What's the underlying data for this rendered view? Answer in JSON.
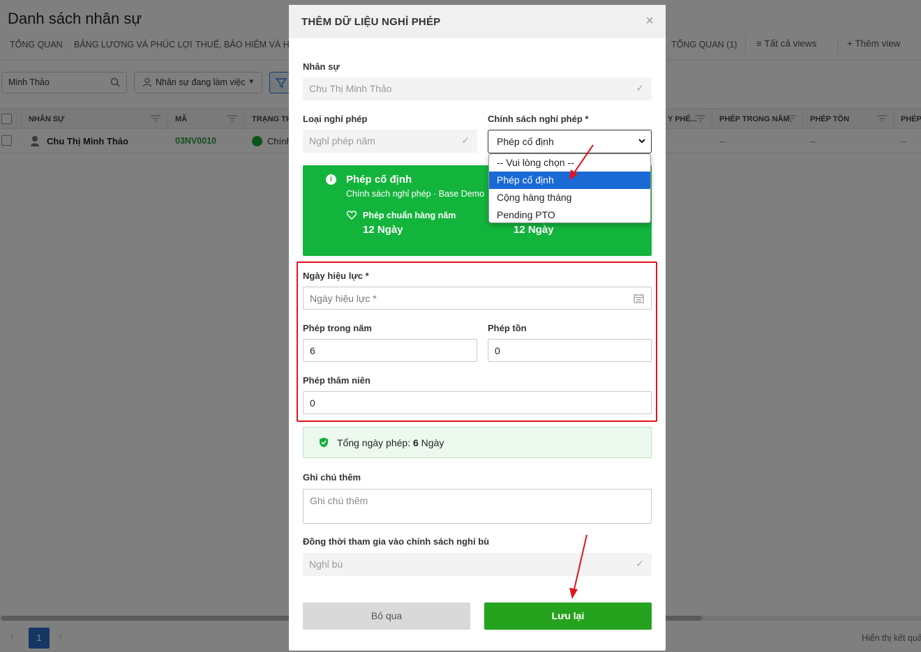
{
  "page": {
    "title": "Danh sách nhân sự",
    "tabs": [
      "TỔNG QUAN",
      "BẢNG LƯƠNG VÀ PHÚC LỢI",
      "THUẾ, BẢO HIỂM VÀ HÀN"
    ],
    "right_tab": "TỔNG QUAN (1)",
    "all_views": "Tất cả views",
    "add_view": "Thêm view",
    "search_value": "Minh Thảo",
    "status_filter": "Nhân sự đang làm việc"
  },
  "table": {
    "headers": [
      "NHÂN SỰ",
      "MÃ",
      "TRẠNG TH",
      "Y PHÉ...",
      "PHÉP TRONG NĂM",
      "PHÉP TỒN",
      "PHÉP"
    ],
    "row": {
      "name": "Chu Thị Minh Thảo",
      "code": "03NV0010",
      "status": "Chính",
      "annual": "–",
      "balance": "–",
      "other": "–"
    }
  },
  "pager": {
    "current": "1",
    "footer": "Hiển thị kết quả"
  },
  "modal": {
    "title": "THÊM DỮ LIỆU NGHỈ PHÉP",
    "close": "×",
    "employee_label": "Nhân sự",
    "employee_value": "Chu Thị Minh Thảo",
    "leave_type_label": "Loại nghỉ phép",
    "leave_type_value": "Nghỉ phép năm",
    "policy_label": "Chính sách nghỉ phép *",
    "policy_value": "Phép cố định",
    "policy_options": [
      "-- Vui lòng chọn --",
      "Phép cố định",
      "Cộng hàng tháng",
      "Pending PTO"
    ],
    "card": {
      "title": "Phép cố định",
      "subtitle": "Chính sách nghỉ phép · Base Demo",
      "standard_label": "Phép chuẩn hàng năm",
      "standard_value": "12 Ngày",
      "right_value": "12 Ngày"
    },
    "effective_date_label": "Ngày hiệu lực *",
    "effective_date_placeholder": "Ngày hiệu lực *",
    "annual_label": "Phép trong năm",
    "annual_value": "6",
    "balance_label": "Phép tồn",
    "balance_value": "0",
    "seniority_label": "Phép thâm niên",
    "seniority_value": "0",
    "total_prefix": "Tổng ngày phép:",
    "total_value": "6",
    "total_unit": "Ngày",
    "note_label": "Ghi chú thêm",
    "note_placeholder": "Ghi chú thêm",
    "comp_label": "Đồng thời tham gia vào chính sách nghỉ bù",
    "comp_value": "Nghỉ bù",
    "cancel": "Bỏ qua",
    "save": "Lưu lại"
  },
  "colors": {
    "accent_green": "#13b43c",
    "save_green": "#26a31e",
    "highlight_red": "#e0141b",
    "dropdown_active": "#1a6ad6"
  }
}
